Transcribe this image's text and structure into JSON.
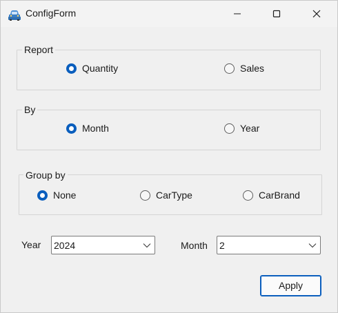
{
  "window": {
    "title": "ConfigForm",
    "icon": "car-icon"
  },
  "titlebar": {
    "minimize_icon": "minimize-icon",
    "maximize_icon": "maximize-icon",
    "close_icon": "close-icon"
  },
  "report": {
    "label": "Report",
    "options": [
      {
        "label": "Quantity",
        "checked": true
      },
      {
        "label": "Sales",
        "checked": false
      }
    ]
  },
  "by": {
    "label": "By",
    "options": [
      {
        "label": "Month",
        "checked": true
      },
      {
        "label": "Year",
        "checked": false
      }
    ]
  },
  "group_by": {
    "label": "Group by",
    "options": [
      {
        "label": "None",
        "checked": true
      },
      {
        "label": "CarType",
        "checked": false
      },
      {
        "label": "CarBrand",
        "checked": false
      }
    ]
  },
  "filters": {
    "year_label": "Year",
    "year_value": "2024",
    "month_label": "Month",
    "month_value": "2"
  },
  "actions": {
    "apply_label": "Apply"
  },
  "colors": {
    "accent": "#0a5ebd",
    "window_bg": "#f0f0f0"
  }
}
